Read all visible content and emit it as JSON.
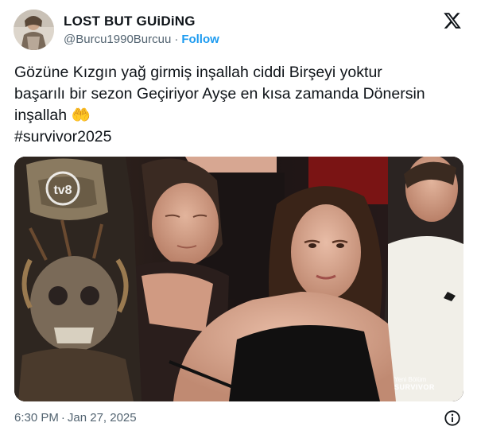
{
  "author": {
    "display_name": "LOST BUT GUiDiNG",
    "handle": "@Burcu1990Burcuu",
    "separator": "·",
    "follow_label": "Follow"
  },
  "tweet": {
    "lines": [
      "Gözüne Kızgın yağ girmiş inşallah ciddi Birşeyi yoktur",
      "başarılı bir sezon Geçiriyor Ayşe en kısa zamanda Dönersin",
      "inşallah"
    ],
    "emoji": "🤲",
    "hashtag": "#survivor2025"
  },
  "media": {
    "channel_logo": "tv8",
    "overlay_line1": "Yeni Bölüm",
    "overlay_line2": "SURVIVOR"
  },
  "footer": {
    "time": "6:30 PM",
    "separator": "·",
    "date": "Jan 27, 2025"
  },
  "icons": {
    "platform_logo": "x-logo-icon",
    "info": "info-icon"
  }
}
